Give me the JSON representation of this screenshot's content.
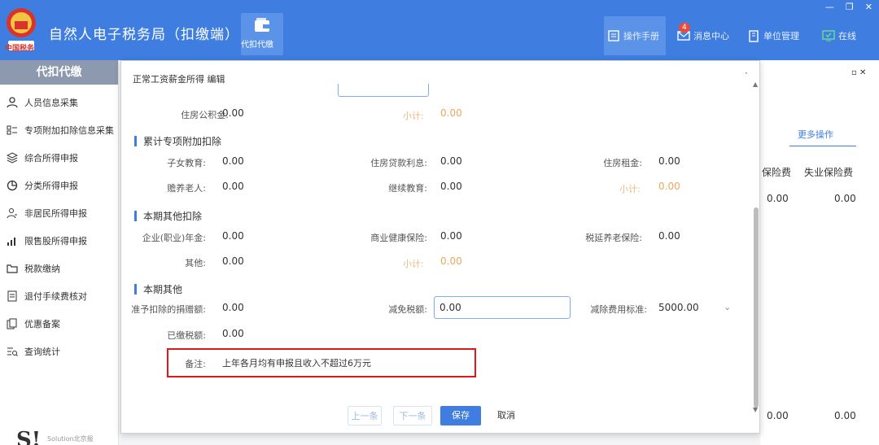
{
  "app": {
    "title": "自然人电子税务局（扣缴端）",
    "module_label": "代扣代缴",
    "logo_text": "中国税务"
  },
  "topbar": {
    "manual": "操作手册",
    "messages": "消息中心",
    "messages_badge": "4",
    "org": "单位管理",
    "online": "在线"
  },
  "sidebar": {
    "header": "代扣代缴",
    "items": [
      {
        "label": "人员信息采集",
        "icon": "person-icon"
      },
      {
        "label": "专项附加扣除信息采集",
        "icon": "list-icon"
      },
      {
        "label": "综合所得申报",
        "icon": "layers-icon"
      },
      {
        "label": "分类所得申报",
        "icon": "pie-icon"
      },
      {
        "label": "非居民所得申报",
        "icon": "person-outline-icon"
      },
      {
        "label": "限售股所得申报",
        "icon": "bar-chart-icon"
      },
      {
        "label": "税款缴纳",
        "icon": "folder-icon"
      },
      {
        "label": "退付手续费核对",
        "icon": "document-icon"
      },
      {
        "label": "优惠备案",
        "icon": "copy-icon"
      },
      {
        "label": "查询统计",
        "icon": "query-icon"
      }
    ],
    "footer_logo": "S!",
    "footer_text": "Solution北京报"
  },
  "background": {
    "more_ops": "更多操作",
    "columns": [
      "保险费",
      "失业保险费"
    ],
    "values": [
      "0.00",
      "0.00"
    ],
    "bottom_values": [
      "0.00",
      "0.00"
    ]
  },
  "modal": {
    "title": "正常工资薪金所得 编辑",
    "housing_fund_label": "住房公积金:",
    "housing_fund_value": "0.00",
    "subtotal_label": "小计:",
    "subtotal_value_1": "0.00",
    "sections": {
      "cumulative": "累计专项附加扣除",
      "other_deduction": "本期其他扣除",
      "other": "本期其他"
    },
    "cumulative": {
      "child_edu_label": "子女教育:",
      "child_edu": "0.00",
      "loan_label": "住房贷款利息:",
      "loan": "0.00",
      "rent_label": "住房租金:",
      "rent": "0.00",
      "elderly_label": "赡养老人:",
      "elderly": "0.00",
      "cont_edu_label": "继续教育:",
      "cont_edu": "0.00",
      "subtotal_label": "小计:",
      "subtotal": "0.00"
    },
    "other_deduction": {
      "annuity_label": "企业(职业)年金:",
      "annuity": "0.00",
      "health_label": "商业健康保险:",
      "health": "0.00",
      "pension_label": "税延养老保险:",
      "pension": "0.00",
      "other_label": "其他:",
      "other": "0.00",
      "subtotal_label": "小计:",
      "subtotal": "0.00"
    },
    "other": {
      "donation_label": "准予扣除的捐赠额:",
      "donation": "0.00",
      "tax_relief_label": "减免税额:",
      "tax_relief": "0.00",
      "expense_std_label": "减除费用标准:",
      "expense_std": "5000.00",
      "paid_tax_label": "已缴税额:",
      "paid_tax": "0.00",
      "remark_label": "备注:",
      "remark": "上年各月均有申报且收入不超过6万元"
    },
    "buttons": {
      "prev": "上一条",
      "next": "下一条",
      "save": "保存",
      "cancel": "取消"
    }
  },
  "colors": {
    "brand": "#3f7ee0",
    "highlight": "#e0161b",
    "subtotal": "#e8a85c"
  }
}
